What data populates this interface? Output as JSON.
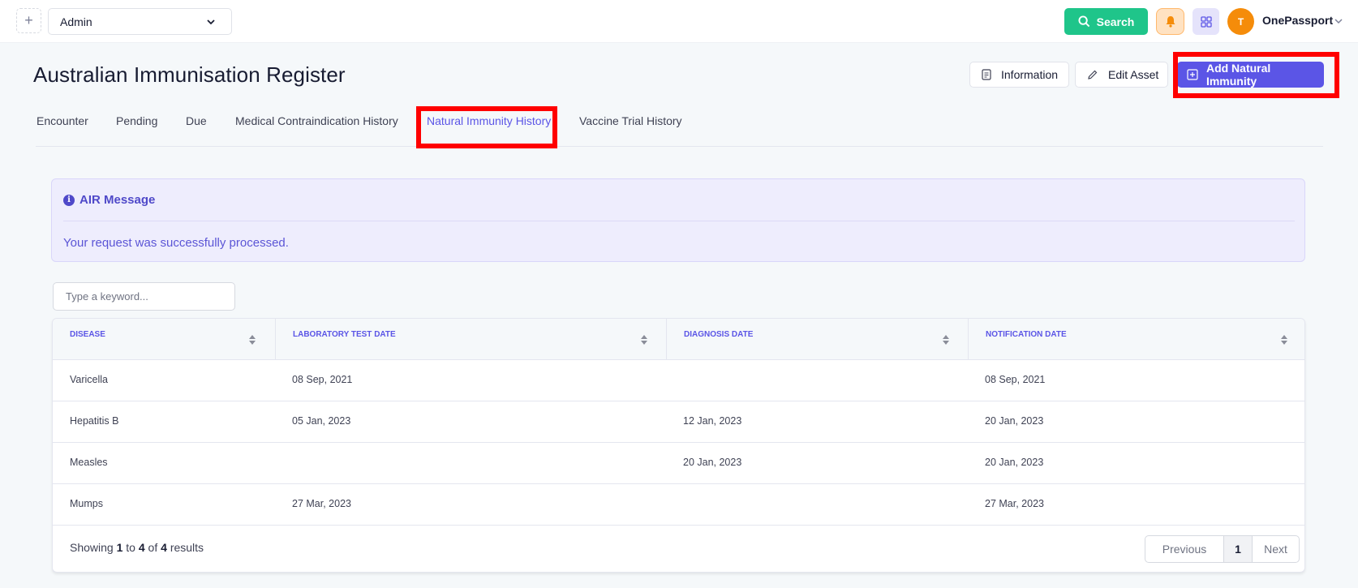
{
  "topbar": {
    "org_select": "Admin",
    "search_label": "Search",
    "avatar_initial": "T",
    "user_name": "OnePassport"
  },
  "page": {
    "title": "Australian Immunisation Register",
    "actions": {
      "information": "Information",
      "edit_asset": "Edit Asset",
      "add_natural_immunity": "Add Natural Immunity"
    }
  },
  "tabs": [
    {
      "label": "Encounter"
    },
    {
      "label": "Pending"
    },
    {
      "label": "Due"
    },
    {
      "label": "Medical Contraindication History"
    },
    {
      "label": "Natural Immunity History",
      "active": true
    },
    {
      "label": "Vaccine Trial History"
    }
  ],
  "alert": {
    "title": "AIR Message",
    "message": "Your request was successfully processed."
  },
  "filter": {
    "placeholder": "Type a keyword..."
  },
  "table": {
    "columns": [
      "DISEASE",
      "LABORATORY TEST DATE",
      "DIAGNOSIS DATE",
      "NOTIFICATION DATE"
    ],
    "rows": [
      [
        "Varicella",
        "08 Sep, 2021",
        "",
        "08 Sep, 2021"
      ],
      [
        "Hepatitis B",
        "05 Jan, 2023",
        "12 Jan, 2023",
        "20 Jan, 2023"
      ],
      [
        "Measles",
        "",
        "20 Jan, 2023",
        "20 Jan, 2023"
      ],
      [
        "Mumps",
        "27 Mar, 2023",
        "",
        "27 Mar, 2023"
      ]
    ],
    "footer": {
      "showing": "Showing",
      "from": "1",
      "to_word": "to",
      "to": "4",
      "of_word": "of",
      "total": "4",
      "results_word": "results"
    },
    "pagination": {
      "previous": "Previous",
      "page": "1",
      "next": "Next"
    }
  },
  "colors": {
    "primary": "#5b55e6",
    "search_green": "#1fc58a",
    "avatar_orange": "#f58c0a",
    "highlight_red": "#ff0000"
  },
  "icons": [
    "plus-icon",
    "chevron-down-icon",
    "search-icon",
    "bell-icon",
    "apps-grid-icon",
    "document-icon",
    "pencil-icon",
    "plus-square-icon",
    "info-icon",
    "sort-icon"
  ]
}
